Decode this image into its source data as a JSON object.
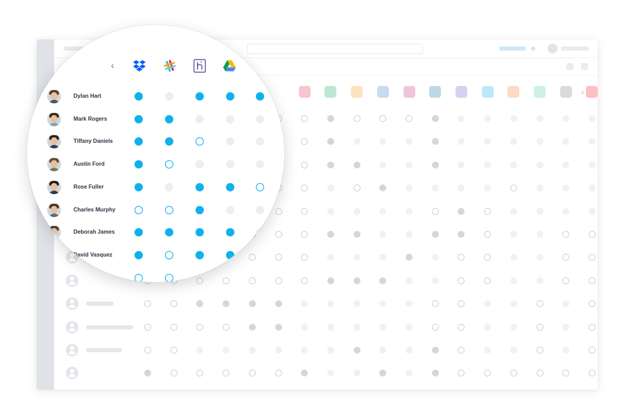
{
  "palette": {
    "accent": "#0fb1ec",
    "dropbox": "#0061fe",
    "heroku": "#6762a6",
    "fab": "#a3e9c4",
    "bubbles": [
      "#f7c6cf",
      "#bfe5d4",
      "#fde3bf",
      "#c9dbf3",
      "#f2c4da",
      "#bfd8e7",
      "#d4d2f0",
      "#bde8fb",
      "#fddac4",
      "#cdf1e0",
      "#d9dadc",
      "#fbc0c0"
    ]
  },
  "icons": {
    "back": "chevron-left-icon",
    "more": "chevron-right-icon",
    "add": "plus-icon",
    "apps": [
      "dropbox-icon",
      "slack-icon",
      "heroku-icon",
      "google-drive-icon"
    ]
  },
  "magnified": {
    "back_glyph": "‹",
    "users": [
      {
        "name": "Dylan Hart",
        "access": [
          "on",
          "off",
          "on",
          "on",
          "on"
        ]
      },
      {
        "name": "Mark Rogers",
        "access": [
          "on",
          "on",
          "off",
          "off",
          "off"
        ]
      },
      {
        "name": "Tiffany Daniels",
        "access": [
          "on",
          "on",
          "pending",
          "off",
          "off"
        ]
      },
      {
        "name": "Austin Ford",
        "access": [
          "on",
          "pending",
          "off",
          "off",
          "off"
        ]
      },
      {
        "name": "Rose Fuller",
        "access": [
          "on",
          "off",
          "on",
          "on",
          "pending"
        ]
      },
      {
        "name": "Charles Murphy",
        "access": [
          "pending",
          "pending",
          "on",
          "off",
          "off"
        ]
      },
      {
        "name": "Deborah James",
        "access": [
          "on",
          "on",
          "on",
          "on",
          "off"
        ]
      },
      {
        "name": "David Vasquez",
        "access": [
          "on",
          "pending",
          "on",
          "on",
          "off"
        ]
      },
      {
        "name": "",
        "access": [
          "pending",
          "pending",
          "off",
          "off",
          "off"
        ]
      }
    ]
  },
  "grid": {
    "more_glyph": "›",
    "add_glyph": "+",
    "rows": [
      [
        "o",
        "o",
        "o",
        "o",
        "o",
        "o",
        "o",
        "d",
        "o",
        "o",
        "o",
        "d",
        "l",
        "l",
        "l",
        "l",
        "l",
        "l"
      ],
      [
        "o",
        "o",
        "o",
        "o",
        "o",
        "o",
        "o",
        "d",
        "l",
        "l",
        "l",
        "d",
        "l",
        "l",
        "l",
        "l",
        "l",
        "l"
      ],
      [
        "o",
        "o",
        "o",
        "o",
        "o",
        "o",
        "o",
        "d",
        "d",
        "l",
        "l",
        "d",
        "l",
        "l",
        "l",
        "l",
        "l",
        "l"
      ],
      [
        "o",
        "o",
        "o",
        "o",
        "o",
        "o",
        "o",
        "l",
        "o",
        "d",
        "l",
        "l",
        "l",
        "l",
        "o",
        "l",
        "l",
        "l"
      ],
      [
        "o",
        "o",
        "o",
        "o",
        "o",
        "o",
        "o",
        "l",
        "l",
        "l",
        "l",
        "o",
        "d",
        "o",
        "l",
        "l",
        "l",
        "l"
      ],
      [
        "o",
        "o",
        "o",
        "o",
        "o",
        "o",
        "o",
        "d",
        "d",
        "l",
        "l",
        "d",
        "d",
        "o",
        "l",
        "l",
        "o",
        "o"
      ],
      [
        "o",
        "o",
        "o",
        "o",
        "o",
        "o",
        "o",
        "l",
        "l",
        "l",
        "d",
        "l",
        "o",
        "o",
        "l",
        "l",
        "o",
        "o"
      ],
      [
        "o",
        "o",
        "o",
        "o",
        "o",
        "o",
        "o",
        "d",
        "d",
        "d",
        "l",
        "l",
        "o",
        "o",
        "l",
        "l",
        "o",
        "o"
      ],
      [
        "o",
        "o",
        "d",
        "d",
        "d",
        "d",
        "l",
        "l",
        "l",
        "l",
        "l",
        "o",
        "o",
        "l",
        "l",
        "o",
        "l",
        "o"
      ],
      [
        "o",
        "o",
        "o",
        "o",
        "d",
        "d",
        "l",
        "l",
        "l",
        "l",
        "l",
        "o",
        "o",
        "l",
        "l",
        "o",
        "l",
        "o"
      ],
      [
        "o",
        "o",
        "l",
        "l",
        "l",
        "l",
        "l",
        "l",
        "d",
        "l",
        "l",
        "d",
        "o",
        "l",
        "l",
        "o",
        "l",
        "o"
      ],
      [
        "d",
        "o",
        "o",
        "o",
        "o",
        "o",
        "d",
        "l",
        "l",
        "d",
        "l",
        "d",
        "o",
        "o",
        "o",
        "o",
        "o",
        "o"
      ]
    ]
  }
}
